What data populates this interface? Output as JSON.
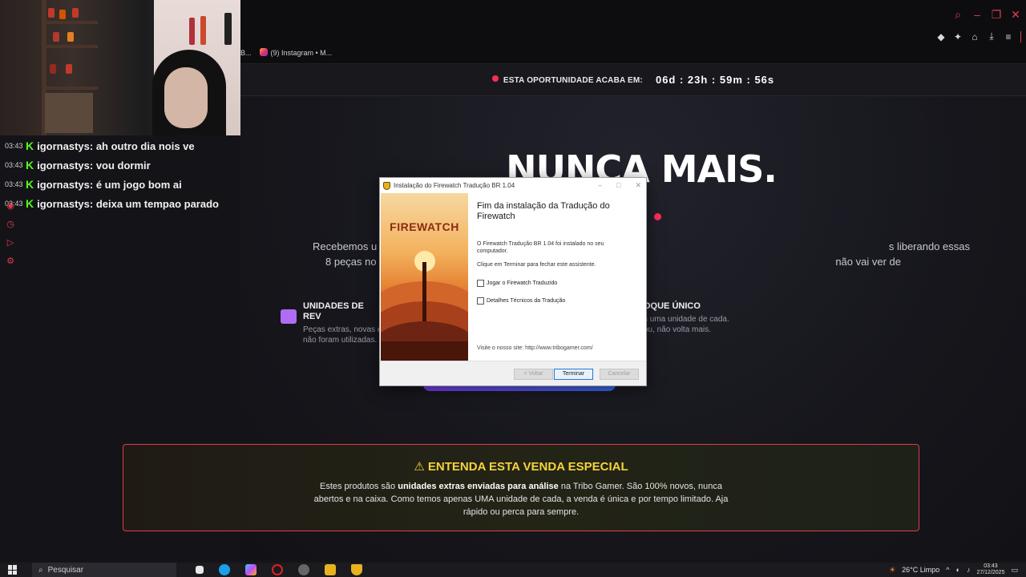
{
  "browser": {
    "tabs": [
      {
        "label": "B..."
      },
      {
        "label": "(9) Instagram • M..."
      }
    ]
  },
  "banner": {
    "text": "ESTA OPORTUNIDADE ACABA EM:",
    "timer": "06d : 23h : 59m : 56s"
  },
  "hero": {
    "title": "NUNCA MAIS.",
    "sub_line1_left": "Recebemos u",
    "sub_line1_right": "s liberando essas",
    "sub_line2_left": "8 peças no",
    "sub_line2_right": "não vai ver de"
  },
  "features": {
    "left_title": "UNIDADES DE REV",
    "left_line1": "Peças extras, novas e",
    "left_line2": "não foram utilizadas.",
    "right_title": "OQUE ÚNICO",
    "right_line1": "s uma unidade de cada.",
    "right_line2": "ou, não volta mais."
  },
  "notice": {
    "title": "⚠ ENTENDA ESTA VENDA ESPECIAL",
    "body_pre": "Estes produtos são ",
    "body_bold": "unidades extras enviadas para análise",
    "body_post": " na Tribo Gamer. São 100% novos, nunca abertos e na caixa. Como temos apenas UMA unidade de cada, a venda é única e por tempo limitado. Aja rápido ou perca para sempre."
  },
  "chat": [
    {
      "time": "03:43",
      "user": "igornastys",
      "message": "ah outro dia nois ve"
    },
    {
      "time": "03:43",
      "user": "igornastys",
      "message": "vou dormir"
    },
    {
      "time": "03:43",
      "user": "igornastys",
      "message": "é um jogo bom ai"
    },
    {
      "time": "03:43",
      "user": "igornastys",
      "message": "deixa um tempao parado"
    }
  ],
  "dialog": {
    "title": "Instalação do Firewatch Tradução BR 1.04",
    "art_logo": "FIREWATCH",
    "heading": "Fim da instalação da Tradução do Firewatch",
    "installed_text": "O Firewatch Tradução BR 1.04 foi instalado no seu computador.",
    "finish_text": "Clique em Terminar para fechar este assistente.",
    "check_play": "Jogar o Firewatch Traduzido",
    "check_details": "Detalhes Técnicos da Tradução",
    "visit_link": "Visite o nosso site: http://www.tribogamer.com/",
    "btn_back": "< Voltar",
    "btn_finish": "Terminar",
    "btn_cancel": "Cancelar"
  },
  "taskbar": {
    "search_placeholder": "Pesquisar",
    "weather": "26°C  Limpo",
    "time": "03:43",
    "date": "27/12/2025"
  },
  "colors": {
    "accent_red": "#e23b4e",
    "warning_yellow": "#f6d33a",
    "chat_green": "#53fc18"
  }
}
